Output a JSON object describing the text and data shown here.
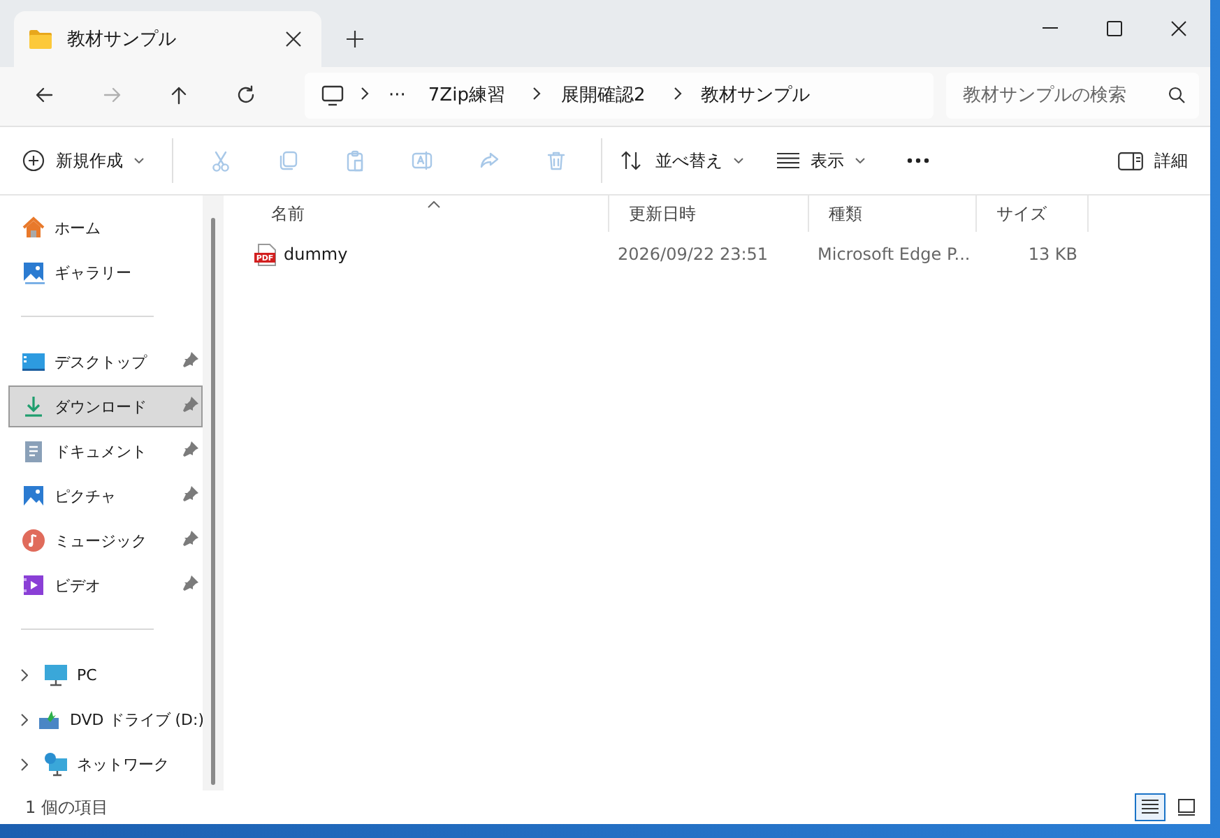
{
  "tab": {
    "title": "教材サンプル"
  },
  "nav_buttons": [
    {
      "kind": "back",
      "disabled": false
    },
    {
      "kind": "forward",
      "disabled": true
    },
    {
      "kind": "up",
      "disabled": false
    },
    {
      "kind": "refresh",
      "disabled": false
    }
  ],
  "breadcrumb": {
    "overflow": "···",
    "segments": [
      "7Zip練習",
      "展開確認2",
      "教材サンプル"
    ]
  },
  "search": {
    "placeholder": "教材サンプルの検索"
  },
  "toolbar": {
    "new_label": "新規作成",
    "actions": [
      {
        "kind": "cut",
        "disabled": true
      },
      {
        "kind": "copy",
        "disabled": true
      },
      {
        "kind": "paste",
        "disabled": true
      },
      {
        "kind": "rename",
        "disabled": true
      },
      {
        "kind": "share",
        "disabled": true
      },
      {
        "kind": "delete",
        "disabled": true
      }
    ],
    "sort_label": "並べ替え",
    "view_label": "表示",
    "details_label": "詳細"
  },
  "sidebar": {
    "groups": [
      [
        {
          "kind": "home",
          "label": "ホーム",
          "pinned": false,
          "selected": false,
          "expandable": false
        },
        {
          "kind": "gallery",
          "label": "ギャラリー",
          "pinned": false,
          "selected": false,
          "expandable": false
        }
      ],
      [
        {
          "kind": "desktop",
          "label": "デスクトップ",
          "pinned": true,
          "selected": false,
          "expandable": false
        },
        {
          "kind": "download",
          "label": "ダウンロード",
          "pinned": true,
          "selected": true,
          "expandable": false
        },
        {
          "kind": "documents",
          "label": "ドキュメント",
          "pinned": true,
          "selected": false,
          "expandable": false
        },
        {
          "kind": "pictures",
          "label": "ピクチャ",
          "pinned": true,
          "selected": false,
          "expandable": false
        },
        {
          "kind": "music",
          "label": "ミュージック",
          "pinned": true,
          "selected": false,
          "expandable": false
        },
        {
          "kind": "videos",
          "label": "ビデオ",
          "pinned": true,
          "selected": false,
          "expandable": false
        }
      ],
      [
        {
          "kind": "pc",
          "label": "PC",
          "pinned": false,
          "selected": false,
          "expandable": true
        },
        {
          "kind": "dvd",
          "label": "DVD ドライブ (D:)",
          "pinned": false,
          "selected": false,
          "expandable": true
        },
        {
          "kind": "network",
          "label": "ネットワーク",
          "pinned": false,
          "selected": false,
          "expandable": true
        }
      ]
    ]
  },
  "table": {
    "columns": [
      {
        "label": "名前",
        "sorted": true
      },
      {
        "label": "更新日時",
        "sorted": false
      },
      {
        "label": "種類",
        "sorted": false
      },
      {
        "label": "サイズ",
        "sorted": false
      }
    ],
    "rows": [
      {
        "kind": "pdf",
        "icon_label": "PDF",
        "name": "dummy",
        "modified": "2026/09/22 23:51",
        "type": "Microsoft Edge P...",
        "size": "13 KB"
      }
    ]
  },
  "status_bar": {
    "count": "1 個の項目",
    "views": [
      {
        "kind": "details",
        "selected": true
      },
      {
        "kind": "tiles",
        "selected": false
      }
    ]
  }
}
